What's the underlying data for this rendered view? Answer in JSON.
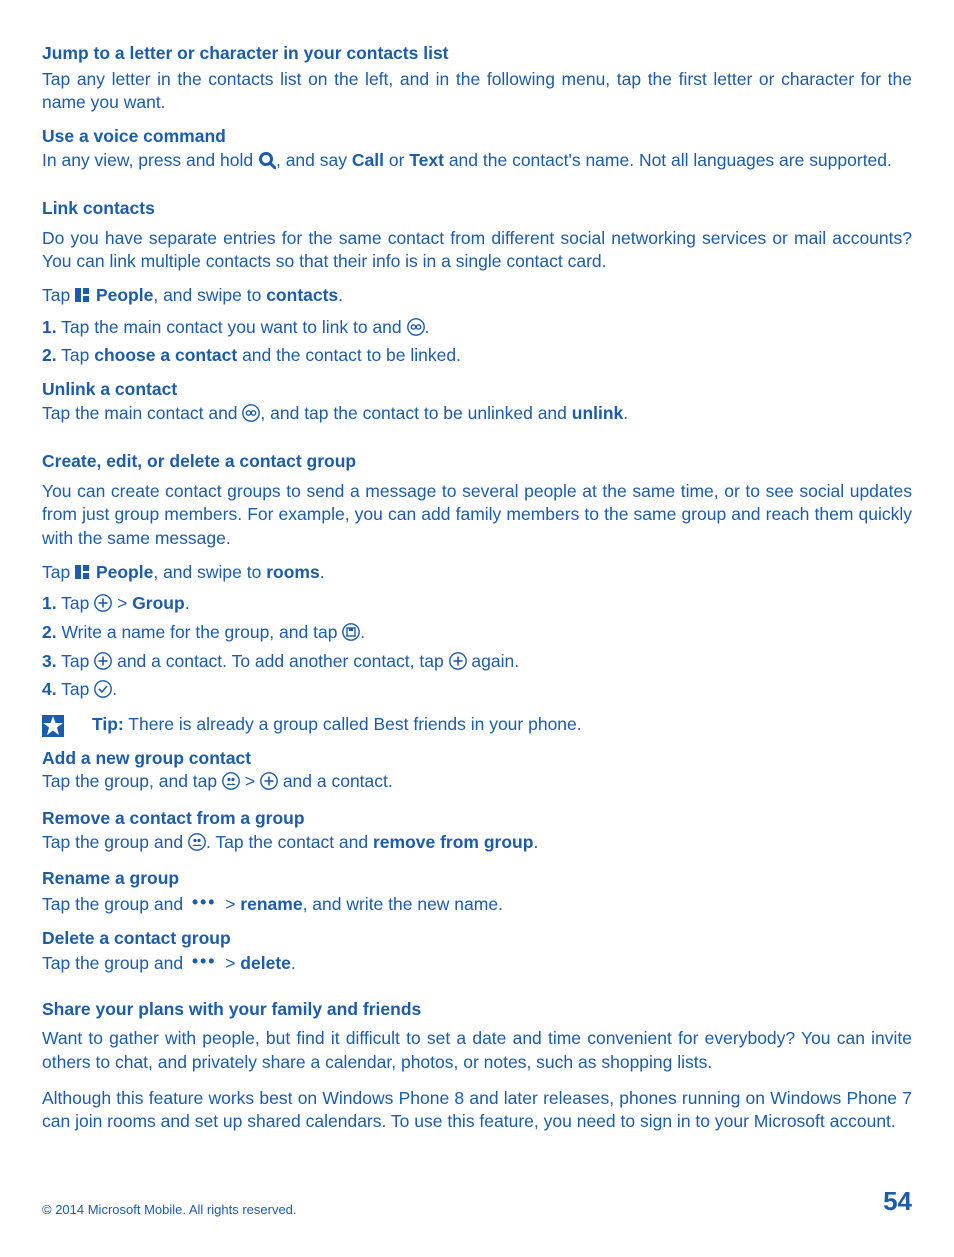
{
  "s1": {
    "h": "Jump to a letter or character in your contacts list",
    "p": "Tap any letter in the contacts list on the left, and in the following menu, tap the first letter or character for the name you want."
  },
  "s2": {
    "h": "Use a voice command",
    "p1": "In any view, press and hold ",
    "p2": ", and say ",
    "call": "Call",
    "or": " or ",
    "text": "Text",
    "p3": " and the contact's name. Not all languages are supported."
  },
  "s3": {
    "h": "Link contacts",
    "p": "Do you have separate entries for the same contact from different social networking services or mail accounts? You can link multiple contacts so that their info is in a single contact card.",
    "tap": "Tap ",
    "people": "People",
    "swipe": ", and swipe to ",
    "contacts": "contacts",
    "dot": ".",
    "n1": "1.",
    "l1a": " Tap the main contact you want to link to and ",
    "l1b": ".",
    "n2": "2.",
    "l2a": " Tap ",
    "choose": "choose a contact",
    "l2b": " and the contact to be linked."
  },
  "s4": {
    "h": "Unlink a contact",
    "p1": "Tap the main contact and ",
    "p2": ", and tap the contact to be unlinked and ",
    "unlink": "unlink",
    "dot": "."
  },
  "s5": {
    "h": "Create, edit, or delete a contact group",
    "p": "You can create contact groups to send a message to several people at the same time, or to see social updates from just group members. For example, you can add family members to the same group and reach them quickly with the same message.",
    "tap": "Tap ",
    "people": "People",
    "swipe": ", and swipe to ",
    "rooms": "rooms",
    "dot": ".",
    "n1": "1.",
    "l1a": " Tap ",
    "l1b": " > ",
    "group": "Group",
    "l1c": ".",
    "n2": "2.",
    "l2a": " Write a name for the group, and tap ",
    "l2b": ".",
    "n3": "3.",
    "l3a": " Tap ",
    "l3b": " and a contact. To add another contact, tap ",
    "l3c": " again.",
    "n4": "4.",
    "l4a": " Tap ",
    "l4b": "."
  },
  "tip": {
    "label": "Tip:",
    "text": " There is already a group called Best friends in your phone."
  },
  "s6": {
    "h": "Add a new group contact",
    "p1": "Tap the group, and tap ",
    "p2": " > ",
    "p3": " and a contact."
  },
  "s7": {
    "h": "Remove a contact from a group",
    "p1": "Tap the group and ",
    "p2": ". Tap the contact and ",
    "remove": "remove from group",
    "dot": "."
  },
  "s8": {
    "h": "Rename a group",
    "p1": "Tap the group and ",
    "p2": " > ",
    "rename": "rename",
    "p3": ", and write the new name."
  },
  "s9": {
    "h": "Delete a contact group",
    "p1": "Tap the group and ",
    "p2": " > ",
    "delete": "delete",
    "dot": "."
  },
  "s10": {
    "h": "Share your plans with your family and friends",
    "p1": "Want to gather with people, but find it difficult to set a date and time convenient for everybody? You can invite others to chat, and privately share a calendar, photos, or notes, such as shopping lists.",
    "p2": "Although this feature works best on Windows Phone 8 and later releases, phones running on Windows Phone 7 can join rooms and set up shared calendars. To use this feature, you need to sign in to your Microsoft account."
  },
  "footer": {
    "copy": "© 2014 Microsoft Mobile. All rights reserved.",
    "page": "54"
  }
}
